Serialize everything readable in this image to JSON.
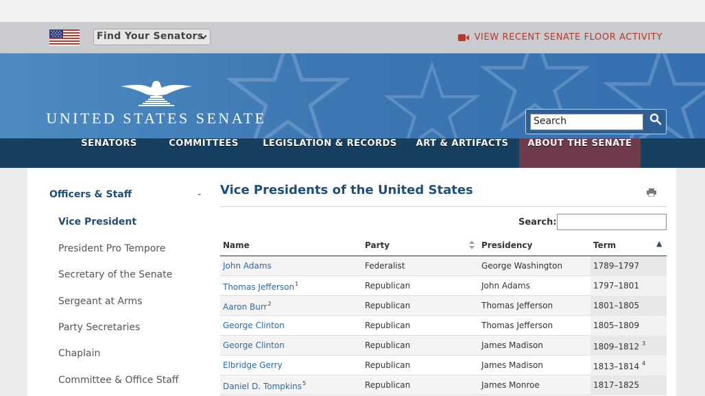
{
  "utility": {
    "finder_label": "Find Your Senators",
    "floor_link": "VIEW RECENT SENATE FLOOR ACTIVITY",
    "accent": "#b13a2c"
  },
  "masthead": {
    "logo_text": "UNITED STATES SENATE",
    "search_placeholder": "Search"
  },
  "nav": {
    "items": [
      {
        "label": "SENATORS"
      },
      {
        "label": "COMMITTEES"
      },
      {
        "label": "LEGISLATION & RECORDS"
      },
      {
        "label": "ART & ARTIFACTS"
      },
      {
        "label": "ABOUT THE SENATE"
      }
    ],
    "active_index": 4,
    "active_color": "#6e3a4c"
  },
  "sidebar": {
    "heading": "Officers & Staff",
    "collapse": "-",
    "items": [
      {
        "label": "Vice President",
        "current": true
      },
      {
        "label": "President Pro Tempore"
      },
      {
        "label": "Secretary of the Senate"
      },
      {
        "label": "Sergeant at Arms"
      },
      {
        "label": "Party Secretaries"
      },
      {
        "label": "Chaplain"
      },
      {
        "label": "Committee & Office Staff"
      }
    ]
  },
  "main": {
    "title": "Vice Presidents of the United States",
    "print_icon": "printer-icon",
    "search_label": "Search:",
    "table": {
      "columns": [
        "Name",
        "Party",
        "Presidency",
        "Term"
      ],
      "sorted_column": "Term",
      "sort_direction": "ascending",
      "rows": [
        {
          "name": "John Adams",
          "name_note": "",
          "party": "Federalist",
          "presidency": "George Washington",
          "term": "1789–1797",
          "term_note": ""
        },
        {
          "name": "Thomas Jefferson",
          "name_note": "1",
          "party": "Republican",
          "presidency": "John Adams",
          "term": "1797–1801",
          "term_note": ""
        },
        {
          "name": "Aaron Burr",
          "name_note": "2",
          "party": "Republican",
          "presidency": "Thomas Jefferson",
          "term": "1801–1805",
          "term_note": ""
        },
        {
          "name": "George Clinton",
          "name_note": "",
          "party": "Republican",
          "presidency": "Thomas Jefferson",
          "term": "1805–1809",
          "term_note": ""
        },
        {
          "name": "George Clinton",
          "name_note": "",
          "party": "Republican",
          "presidency": "James Madison",
          "term": "1809–1812",
          "term_note": "3"
        },
        {
          "name": "Elbridge Gerry",
          "name_note": "",
          "party": "Republican",
          "presidency": "James Madison",
          "term": "1813–1814",
          "term_note": "4"
        },
        {
          "name": "Daniel D. Tompkins",
          "name_note": "5",
          "party": "Republican",
          "presidency": "James Monroe",
          "term": "1817–1825",
          "term_note": ""
        }
      ]
    }
  }
}
